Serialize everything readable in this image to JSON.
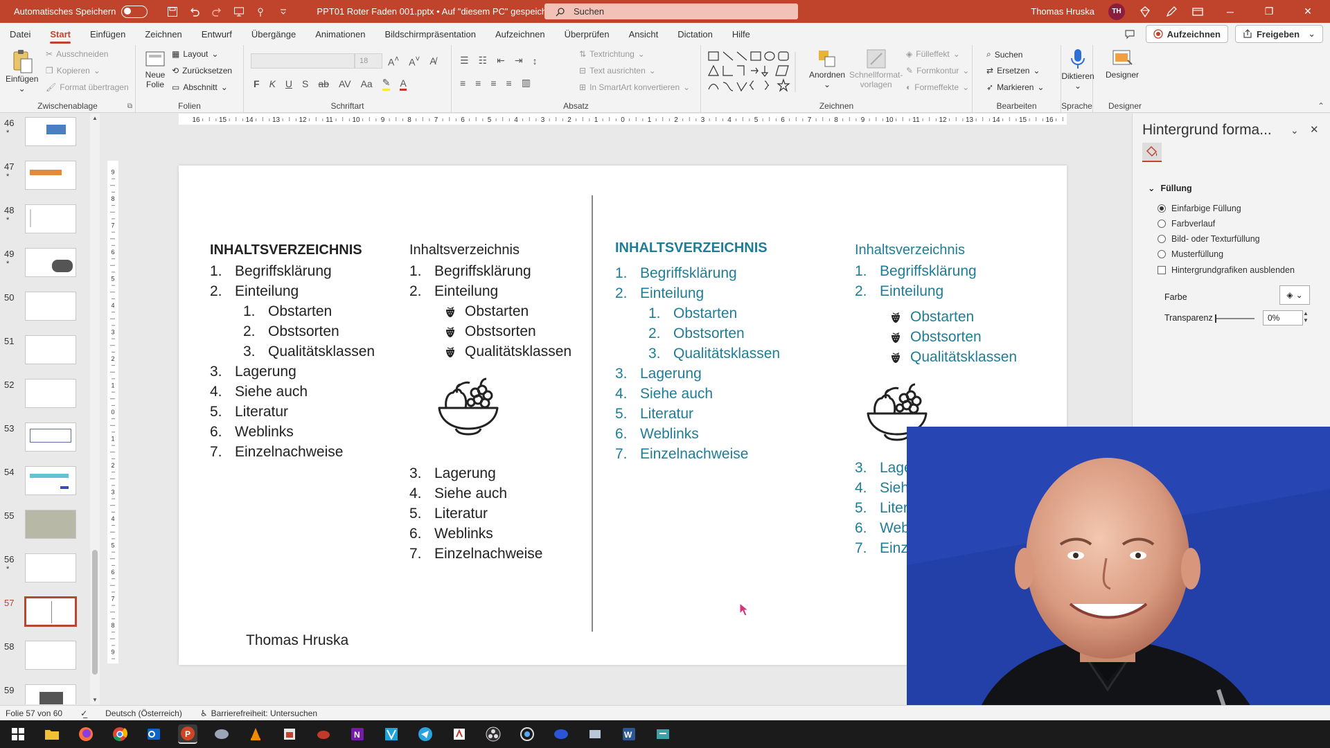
{
  "titlebar": {
    "autosave_label": "Automatisches Speichern",
    "doc_title": "PPT01 Roter Faden 001.pptx  •  Auf \"diesem PC\" gespeichert",
    "search_placeholder": "Suchen",
    "user_name": "Thomas Hruska",
    "user_initials": "TH"
  },
  "menu": {
    "tabs": [
      "Datei",
      "Start",
      "Einfügen",
      "Zeichnen",
      "Entwurf",
      "Übergänge",
      "Animationen",
      "Bildschirmpräsentation",
      "Aufzeichnen",
      "Überprüfen",
      "Ansicht",
      "Dictation",
      "Hilfe"
    ],
    "active_tab": "Start",
    "record_button": "Aufzeichnen",
    "share_button": "Freigeben"
  },
  "ribbon": {
    "clipboard": {
      "label": "Zwischenablage",
      "paste": "Einfügen",
      "cut": "Ausschneiden",
      "copy": "Kopieren",
      "format_painter": "Format übertragen"
    },
    "slides": {
      "label": "Folien",
      "new_slide_1": "Neue",
      "new_slide_2": "Folie",
      "layout": "Layout",
      "reset": "Zurücksetzen",
      "section": "Abschnitt"
    },
    "font": {
      "label": "Schriftart",
      "size": "18"
    },
    "paragraph": {
      "label": "Absatz",
      "text_direction": "Textrichtung",
      "align_text": "Text ausrichten",
      "smartart": "In SmartArt konvertieren"
    },
    "drawing": {
      "label": "Zeichnen",
      "arrange": "Anordnen",
      "quick_styles_1": "Schnellformat-",
      "quick_styles_2": "vorlagen",
      "fill": "Fülleffekt",
      "outline": "Formkontur",
      "effects": "Formeffekte"
    },
    "editing": {
      "label": "Bearbeiten",
      "find": "Suchen",
      "replace": "Ersetzen",
      "select": "Markieren"
    },
    "voice": {
      "label": "Sprache",
      "dictate": "Diktieren"
    },
    "designer": {
      "label": "Designer",
      "button": "Designer"
    }
  },
  "thumbnails": [
    {
      "num": "46",
      "star": "*"
    },
    {
      "num": "47",
      "star": "*"
    },
    {
      "num": "48",
      "star": "*"
    },
    {
      "num": "49",
      "star": "*"
    },
    {
      "num": "50",
      "star": ""
    },
    {
      "num": "51",
      "star": ""
    },
    {
      "num": "52",
      "star": ""
    },
    {
      "num": "53",
      "star": ""
    },
    {
      "num": "54",
      "star": ""
    },
    {
      "num": "55",
      "star": ""
    },
    {
      "num": "56",
      "star": "*"
    },
    {
      "num": "57",
      "star": ""
    },
    {
      "num": "58",
      "star": ""
    },
    {
      "num": "59",
      "star": ""
    }
  ],
  "selected_slide": "57",
  "slide": {
    "col1": {
      "title": "INHALTSVERZEICHNIS",
      "items": [
        {
          "n": "1.",
          "t": "Begriffsklärung"
        },
        {
          "n": "2.",
          "t": "Einteilung"
        },
        {
          "n": "1.",
          "t": "Obstarten",
          "sub": true
        },
        {
          "n": "2.",
          "t": "Obstsorten",
          "sub": true
        },
        {
          "n": "3.",
          "t": "Qualitätsklassen",
          "sub": true
        },
        {
          "n": "3.",
          "t": "Lagerung"
        },
        {
          "n": "4.",
          "t": "Siehe auch"
        },
        {
          "n": "5.",
          "t": "Literatur"
        },
        {
          "n": "6.",
          "t": "Weblinks"
        },
        {
          "n": "7.",
          "t": "Einzelnachweise"
        }
      ]
    },
    "col2": {
      "title": "Inhaltsverzeichnis",
      "items_a": [
        {
          "n": "1.",
          "t": "Begriffsklärung"
        },
        {
          "n": "2.",
          "t": "Einteilung"
        }
      ],
      "bullets": [
        "Obstarten",
        "Obstsorten",
        "Qualitätsklassen"
      ],
      "items_b": [
        {
          "n": "3.",
          "t": "Lagerung"
        },
        {
          "n": "4.",
          "t": "Siehe auch"
        },
        {
          "n": "5.",
          "t": "Literatur"
        },
        {
          "n": "6.",
          "t": "Weblinks"
        },
        {
          "n": "7.",
          "t": "Einzelnachweise"
        }
      ]
    },
    "col3": {
      "title": "INHALTSVERZEICHNIS",
      "items": [
        {
          "n": "1.",
          "t": "Begriffsklärung"
        },
        {
          "n": "2.",
          "t": "Einteilung"
        },
        {
          "n": "1.",
          "t": "Obstarten",
          "sub": true
        },
        {
          "n": "2.",
          "t": "Obstsorten",
          "sub": true
        },
        {
          "n": "3.",
          "t": "Qualitätsklassen",
          "sub": true
        },
        {
          "n": "3.",
          "t": "Lagerung"
        },
        {
          "n": "4.",
          "t": "Siehe auch"
        },
        {
          "n": "5.",
          "t": "Literatur"
        },
        {
          "n": "6.",
          "t": "Weblinks"
        },
        {
          "n": "7.",
          "t": "Einzelnachweise"
        }
      ]
    },
    "col4": {
      "title": "Inhaltsverzeichnis",
      "items_a": [
        {
          "n": "1.",
          "t": "Begriffsklärung"
        },
        {
          "n": "2.",
          "t": "Einteilung"
        }
      ],
      "bullets": [
        "Obstarten",
        "Obstsorten",
        "Qualitätsklassen"
      ],
      "items_b": [
        {
          "n": "3.",
          "t": "Lage"
        },
        {
          "n": "4.",
          "t": "Sieh"
        },
        {
          "n": "5.",
          "t": "Liter"
        },
        {
          "n": "6.",
          "t": "Web"
        },
        {
          "n": "7.",
          "t": "Einz"
        }
      ]
    },
    "author": "Thomas Hruska",
    "text_color": "#222222",
    "accent_color": "#1f7d97"
  },
  "pane": {
    "title": "Hintergrund forma...",
    "section": "Füllung",
    "options": [
      "Einfarbige Füllung",
      "Farbverlauf",
      "Bild- oder Texturfüllung",
      "Musterfüllung"
    ],
    "selected_option": "Einfarbige Füllung",
    "hide_graphics": "Hintergrundgrafiken ausblenden",
    "color_label": "Farbe",
    "transparency_label": "Transparenz",
    "transparency_value": "0%"
  },
  "status": {
    "slide_info": "Folie 57 von 60",
    "language": "Deutsch (Österreich)",
    "accessibility": "Barrierefreiheit: Untersuchen"
  },
  "colors": {
    "titlebar": "#c0432c",
    "accent_blue": "#1f7d97",
    "webcam_bg": "#2c47b8"
  }
}
